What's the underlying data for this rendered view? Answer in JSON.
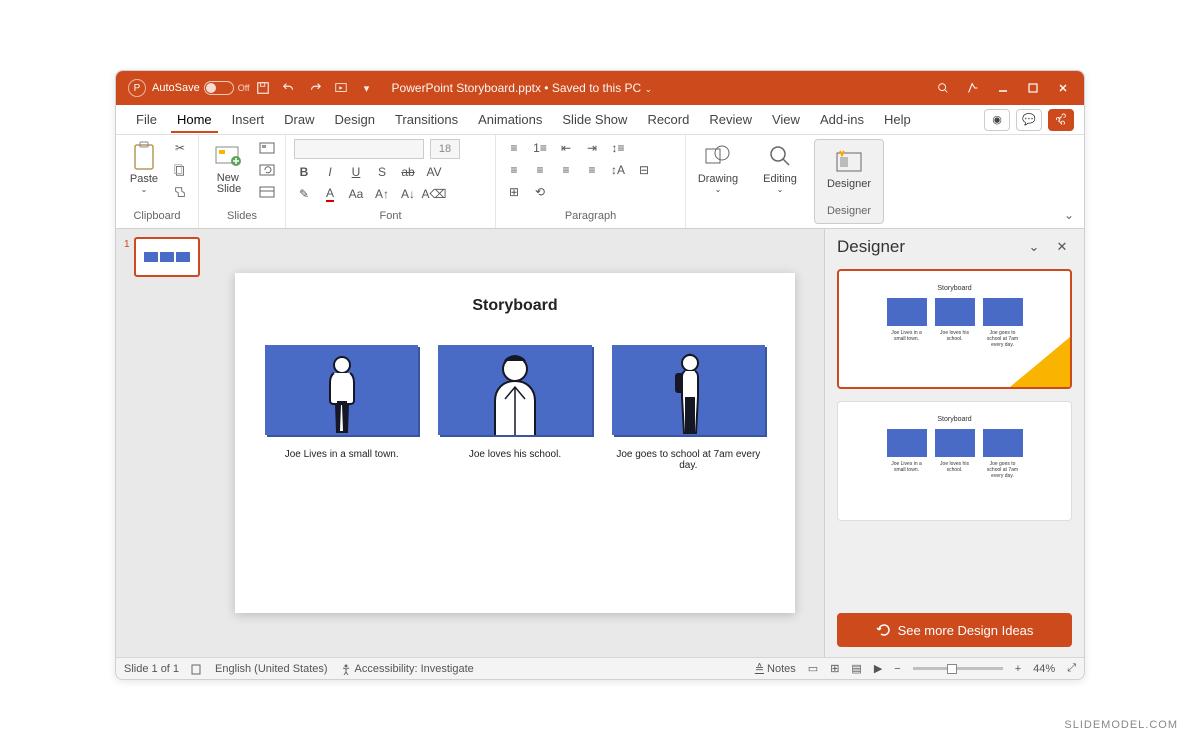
{
  "titlebar": {
    "autosave_label": "AutoSave",
    "autosave_state": "Off",
    "document_title": "PowerPoint Storyboard.pptx • Saved to this PC"
  },
  "tabs": {
    "file": "File",
    "home": "Home",
    "insert": "Insert",
    "draw": "Draw",
    "design": "Design",
    "transitions": "Transitions",
    "animations": "Animations",
    "slideshow": "Slide Show",
    "record": "Record",
    "review": "Review",
    "view": "View",
    "addins": "Add-ins",
    "help": "Help"
  },
  "ribbon": {
    "clipboard_label": "Clipboard",
    "paste_label": "Paste",
    "slides_label": "Slides",
    "new_slide_label": "New\nSlide",
    "font_label": "Font",
    "font_size": "18",
    "paragraph_label": "Paragraph",
    "drawing_label": "Drawing",
    "editing_label": "Editing",
    "designer_label": "Designer",
    "designer_group_label": "Designer"
  },
  "slide": {
    "title": "Storyboard",
    "items": [
      {
        "caption": "Joe Lives in a small town."
      },
      {
        "caption": "Joe loves his school."
      },
      {
        "caption": "Joe goes to school at 7am every day."
      }
    ]
  },
  "thumb": {
    "number": "1"
  },
  "designer_pane": {
    "title": "Designer",
    "see_more": "See more Design Ideas",
    "card_title": "Storyboard",
    "captions": [
      "Joe Lives in a small town.",
      "Joe loves his school.",
      "Joe goes to school at 7am every day."
    ]
  },
  "statusbar": {
    "slide_count": "Slide 1 of 1",
    "language": "English (United States)",
    "accessibility": "Accessibility: Investigate",
    "notes": "Notes",
    "zoom": "44%"
  },
  "watermark": "SLIDEMODEL.COM"
}
